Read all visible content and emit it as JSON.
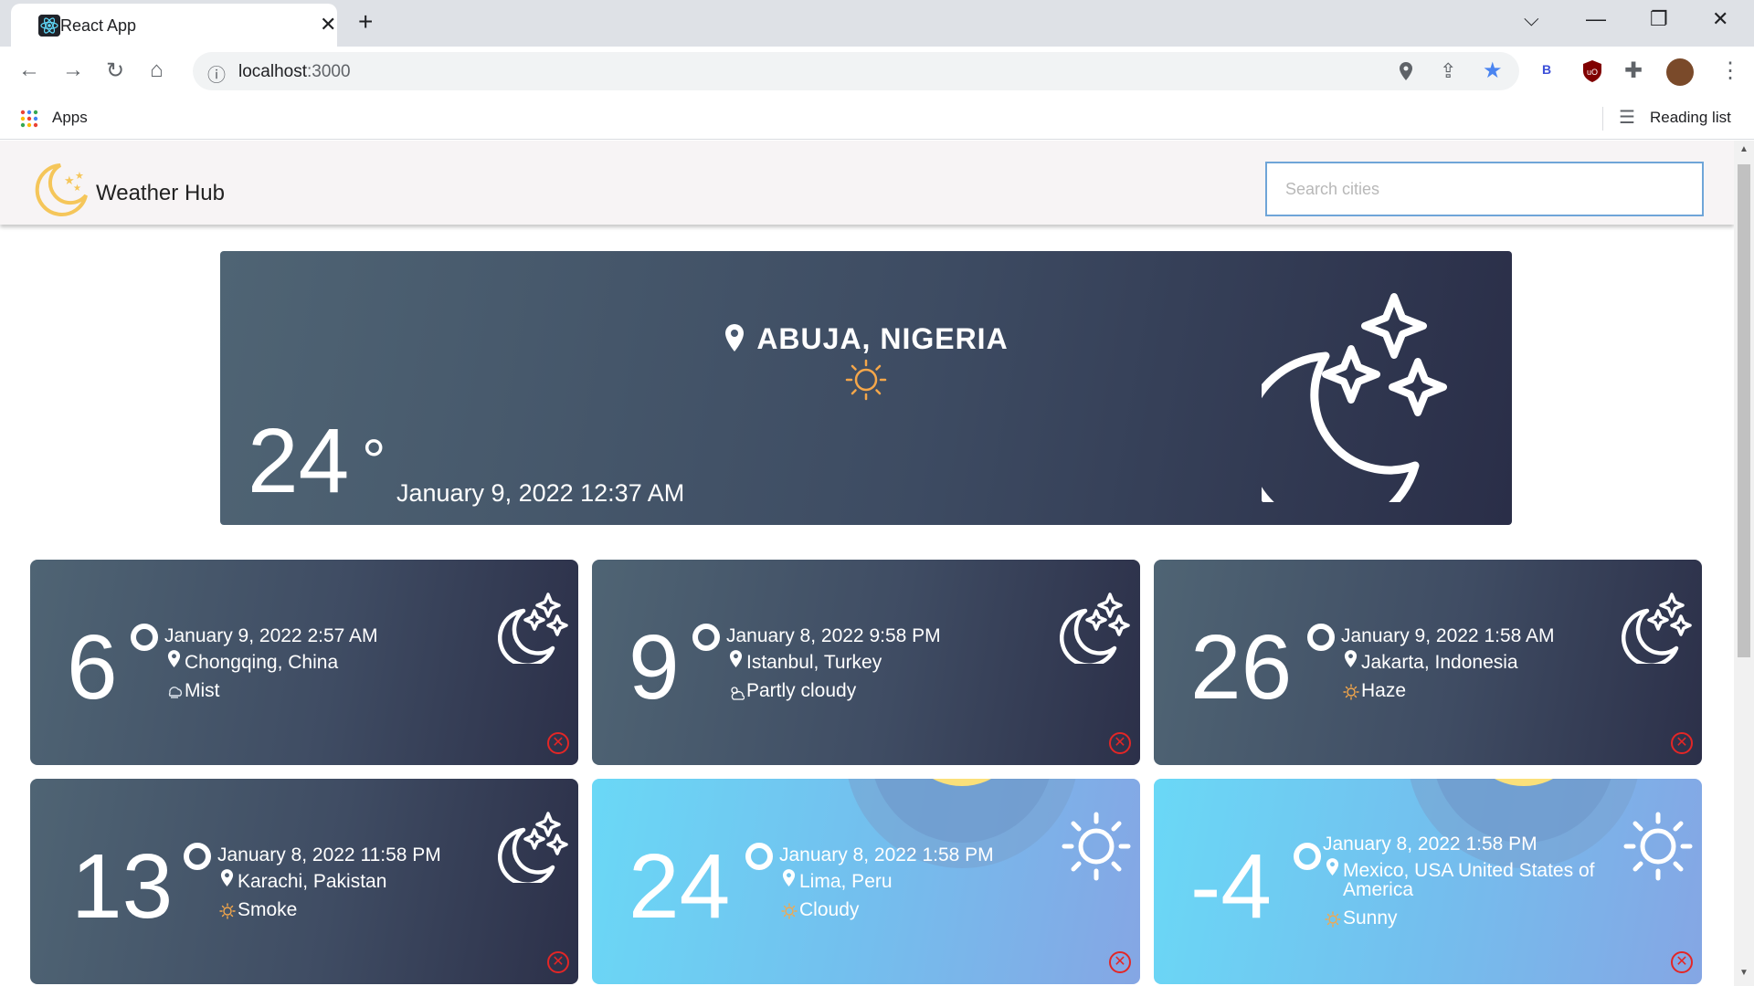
{
  "browser": {
    "tab_title": "React App",
    "url_host": "localhost",
    "url_port": ":3000",
    "bookmarks_apps": "Apps",
    "reading_list": "Reading list",
    "profile_badge": "B"
  },
  "app": {
    "title": "Weather Hub",
    "search_placeholder": "Search cities"
  },
  "hero": {
    "city": "ABUJA, NIGERIA",
    "temp": "24",
    "degree": "°",
    "datetime": "January 9, 2022 12:37 AM"
  },
  "cards": [
    {
      "temp": "6",
      "date": "January 9, 2022 2:57 AM",
      "city": "Chongqing, China",
      "condition": "Mist"
    },
    {
      "temp": "9",
      "date": "January 8, 2022 9:58 PM",
      "city": "Istanbul, Turkey",
      "condition": "Partly cloudy"
    },
    {
      "temp": "26",
      "date": "January 9, 2022 1:58 AM",
      "city": "Jakarta, Indonesia",
      "condition": "Haze"
    },
    {
      "temp": "13",
      "date": "January 8, 2022 11:58 PM",
      "city": "Karachi, Pakistan",
      "condition": "Smoke"
    },
    {
      "temp": "24",
      "date": "January 8, 2022 1:58 PM",
      "city": "Lima, Peru",
      "condition": "Cloudy"
    },
    {
      "temp": "-4",
      "date": "January 8, 2022 1:58 PM",
      "city": "Mexico, USA United States of America",
      "condition": "Sunny"
    }
  ],
  "colors": {
    "accent_blue": "#6fa5d8",
    "close_red": "#e32626",
    "sun_orange": "#f5a74a",
    "logo_yellow": "#f5c65a"
  }
}
